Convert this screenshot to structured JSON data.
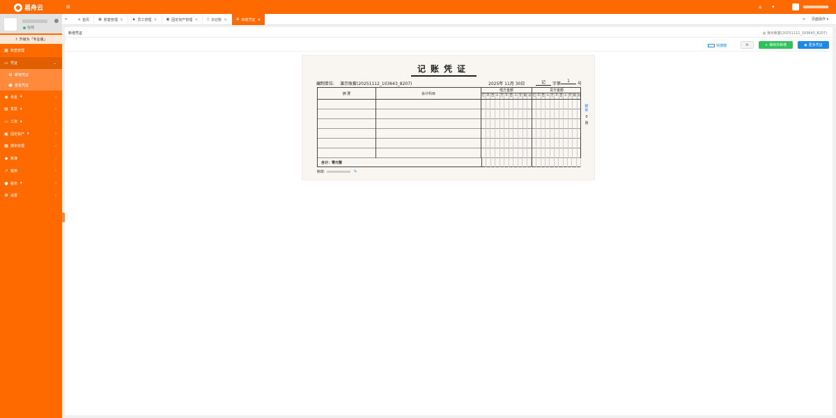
{
  "app": {
    "name": "易舟云"
  },
  "header": {
    "page_ops_label": "页面操作"
  },
  "sidebar": {
    "status": "在线",
    "upgrade_label": "升级为「专业版」",
    "items": [
      {
        "label": "账套管理"
      },
      {
        "label": "凭证",
        "expanded": true,
        "children": [
          {
            "label": "新增凭证"
          },
          {
            "label": "查看凭证"
          }
        ]
      },
      {
        "label": "资金"
      },
      {
        "label": "发票"
      },
      {
        "label": "工资"
      },
      {
        "label": "固定资产"
      },
      {
        "label": "期末处理"
      },
      {
        "label": "账簿"
      },
      {
        "label": "报表"
      },
      {
        "label": "税务"
      },
      {
        "label": "设置"
      }
    ]
  },
  "tabs": [
    {
      "label": "首页"
    },
    {
      "label": "账套管理"
    },
    {
      "label": "员工管理"
    },
    {
      "label": "固定资产管理"
    },
    {
      "label": "日记账"
    },
    {
      "label": "新增凭证",
      "active": true
    }
  ],
  "page": {
    "title": "新增凭证",
    "book_info": "演示账套(20251112_103643_8207)"
  },
  "toolbar": {
    "hotkey_label": "快捷键",
    "save_new_label": "保存并新增",
    "more_label": "更多凭证"
  },
  "voucher": {
    "title": "记账凭证",
    "unit_label": "编制单位:",
    "unit_value": "演示账套(20251112_103643_8207)",
    "date": "2025年 11月 30日",
    "word": "记",
    "zihao_label": "字第",
    "number": "1",
    "hao_label": "号",
    "columns": {
      "summary": "摘 要",
      "subject": "会计科目",
      "debit": "借方金额",
      "credit": "贷方金额"
    },
    "digit_units": [
      "亿",
      "千",
      "百",
      "十",
      "万",
      "千",
      "百",
      "十",
      "元",
      "角",
      "分"
    ],
    "total_label": "合计：零元整",
    "attach_label": "附件",
    "attach_count": "0",
    "attach_unit": "张",
    "maker_label": "制单:"
  },
  "colors": {
    "primary": "#ff6a00",
    "success": "#2fc25b",
    "info": "#1e88e5"
  }
}
